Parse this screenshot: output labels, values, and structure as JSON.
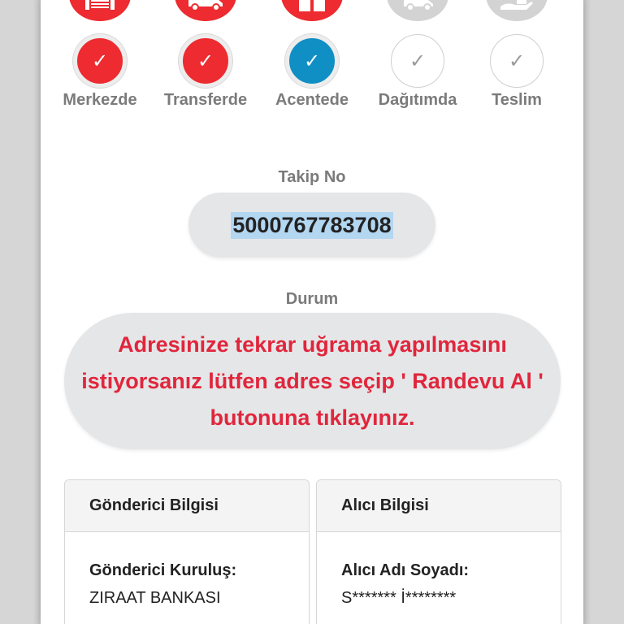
{
  "colors": {
    "done": "#ed2b30",
    "current": "#0f8fc4",
    "pending_icon": "#d3d3d3",
    "status_text": "#e0263c",
    "label_gray": "#7b7b7b",
    "highlight": "#b3d6f1"
  },
  "steps": [
    {
      "label": "Merkezde",
      "state": "done",
      "icon": "warehouse-icon",
      "check": "✓"
    },
    {
      "label": "Transferde",
      "state": "done",
      "icon": "truck-icon",
      "check": "✓"
    },
    {
      "label": "Acentede",
      "state": "current",
      "icon": "package-icon",
      "check": "✓"
    },
    {
      "label": "Dağıtımda",
      "state": "pending",
      "icon": "delivery-vehicle-icon",
      "check": "✓"
    },
    {
      "label": "Teslim",
      "state": "pending",
      "icon": "hand-package-icon",
      "check": "✓"
    }
  ],
  "tracking": {
    "label": "Takip No",
    "number": "5000767783708"
  },
  "status": {
    "label": "Durum",
    "message": "Adresinize tekrar uğrama yapılmasını istiyorsanız lütfen adres seçip ' Randevu Al ' butonuna tıklayınız."
  },
  "sender": {
    "header": "Gönderici Bilgisi",
    "field_label": "Gönderici Kuruluş:",
    "field_value": "ZIRAAT BANKASI"
  },
  "receiver": {
    "header": "Alıcı Bilgisi",
    "field_label": "Alıcı Adı Soyadı:",
    "field_value": "S******* İ********"
  }
}
